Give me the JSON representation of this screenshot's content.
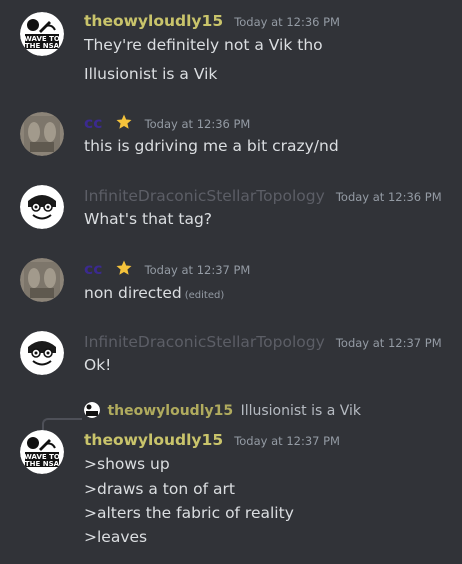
{
  "colors": {
    "background": "#313338",
    "name_theowy": "#c9c46b",
    "name_cc": "#3b2a8f",
    "name_infinite": "#5c5e66",
    "timestamp": "#949ba4",
    "text": "#dbdee1"
  },
  "avatars": {
    "wave": {
      "line1": "WAVE TO",
      "line2": "THE NSA"
    }
  },
  "messages": [
    {
      "author": "theowyloudly15",
      "timestamp": "Today at 12:36 PM",
      "lines": [
        "They're definitely not a Vik tho",
        "Illusionist is a Vik"
      ]
    },
    {
      "author": "cc",
      "badge": "star-icon",
      "timestamp": "Today at 12:36 PM",
      "lines": [
        "this is gdriving me a bit crazy/nd"
      ]
    },
    {
      "author": "InfiniteDraconicStellarTopology",
      "timestamp": "Today at 12:36 PM",
      "lines": [
        "What's that tag?"
      ]
    },
    {
      "author": "cc",
      "badge": "star-icon",
      "timestamp": "Today at 12:37 PM",
      "lines": [
        "non directed"
      ],
      "edited": "(edited)"
    },
    {
      "author": "InfiniteDraconicStellarTopology",
      "timestamp": "Today at 12:37 PM",
      "lines": [
        "Ok!"
      ]
    },
    {
      "author": "theowyloudly15",
      "timestamp": "Today at 12:37 PM",
      "reply": {
        "author": "theowyloudly15",
        "text": "Illusionist is a Vik"
      },
      "lines": [
        ">shows up",
        ">draws a ton of art",
        ">alters the fabric of reality",
        ">leaves"
      ]
    }
  ]
}
